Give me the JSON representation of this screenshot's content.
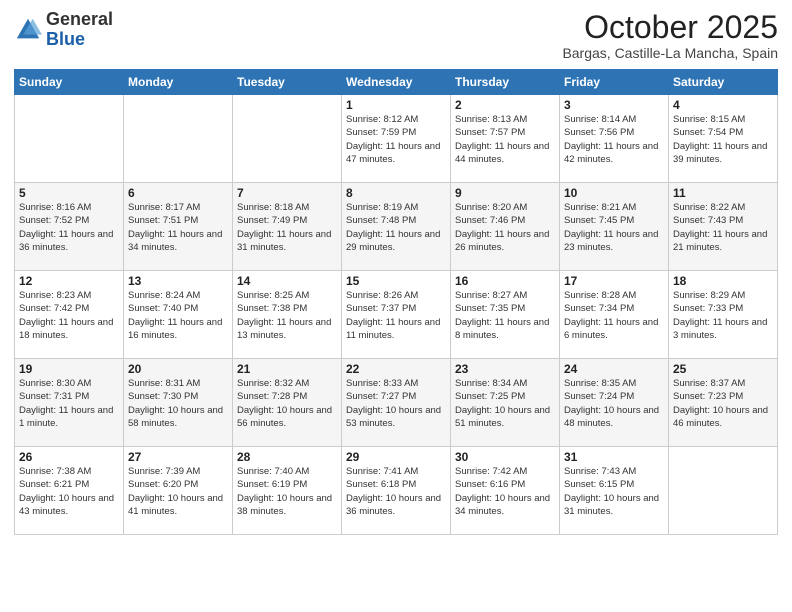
{
  "logo": {
    "general": "General",
    "blue": "Blue"
  },
  "header": {
    "month": "October 2025",
    "location": "Bargas, Castille-La Mancha, Spain"
  },
  "weekdays": [
    "Sunday",
    "Monday",
    "Tuesday",
    "Wednesday",
    "Thursday",
    "Friday",
    "Saturday"
  ],
  "weeks": [
    [
      {
        "day": "",
        "sunrise": "",
        "sunset": "",
        "daylight": ""
      },
      {
        "day": "",
        "sunrise": "",
        "sunset": "",
        "daylight": ""
      },
      {
        "day": "",
        "sunrise": "",
        "sunset": "",
        "daylight": ""
      },
      {
        "day": "1",
        "sunrise": "Sunrise: 8:12 AM",
        "sunset": "Sunset: 7:59 PM",
        "daylight": "Daylight: 11 hours and 47 minutes."
      },
      {
        "day": "2",
        "sunrise": "Sunrise: 8:13 AM",
        "sunset": "Sunset: 7:57 PM",
        "daylight": "Daylight: 11 hours and 44 minutes."
      },
      {
        "day": "3",
        "sunrise": "Sunrise: 8:14 AM",
        "sunset": "Sunset: 7:56 PM",
        "daylight": "Daylight: 11 hours and 42 minutes."
      },
      {
        "day": "4",
        "sunrise": "Sunrise: 8:15 AM",
        "sunset": "Sunset: 7:54 PM",
        "daylight": "Daylight: 11 hours and 39 minutes."
      }
    ],
    [
      {
        "day": "5",
        "sunrise": "Sunrise: 8:16 AM",
        "sunset": "Sunset: 7:52 PM",
        "daylight": "Daylight: 11 hours and 36 minutes."
      },
      {
        "day": "6",
        "sunrise": "Sunrise: 8:17 AM",
        "sunset": "Sunset: 7:51 PM",
        "daylight": "Daylight: 11 hours and 34 minutes."
      },
      {
        "day": "7",
        "sunrise": "Sunrise: 8:18 AM",
        "sunset": "Sunset: 7:49 PM",
        "daylight": "Daylight: 11 hours and 31 minutes."
      },
      {
        "day": "8",
        "sunrise": "Sunrise: 8:19 AM",
        "sunset": "Sunset: 7:48 PM",
        "daylight": "Daylight: 11 hours and 29 minutes."
      },
      {
        "day": "9",
        "sunrise": "Sunrise: 8:20 AM",
        "sunset": "Sunset: 7:46 PM",
        "daylight": "Daylight: 11 hours and 26 minutes."
      },
      {
        "day": "10",
        "sunrise": "Sunrise: 8:21 AM",
        "sunset": "Sunset: 7:45 PM",
        "daylight": "Daylight: 11 hours and 23 minutes."
      },
      {
        "day": "11",
        "sunrise": "Sunrise: 8:22 AM",
        "sunset": "Sunset: 7:43 PM",
        "daylight": "Daylight: 11 hours and 21 minutes."
      }
    ],
    [
      {
        "day": "12",
        "sunrise": "Sunrise: 8:23 AM",
        "sunset": "Sunset: 7:42 PM",
        "daylight": "Daylight: 11 hours and 18 minutes."
      },
      {
        "day": "13",
        "sunrise": "Sunrise: 8:24 AM",
        "sunset": "Sunset: 7:40 PM",
        "daylight": "Daylight: 11 hours and 16 minutes."
      },
      {
        "day": "14",
        "sunrise": "Sunrise: 8:25 AM",
        "sunset": "Sunset: 7:38 PM",
        "daylight": "Daylight: 11 hours and 13 minutes."
      },
      {
        "day": "15",
        "sunrise": "Sunrise: 8:26 AM",
        "sunset": "Sunset: 7:37 PM",
        "daylight": "Daylight: 11 hours and 11 minutes."
      },
      {
        "day": "16",
        "sunrise": "Sunrise: 8:27 AM",
        "sunset": "Sunset: 7:35 PM",
        "daylight": "Daylight: 11 hours and 8 minutes."
      },
      {
        "day": "17",
        "sunrise": "Sunrise: 8:28 AM",
        "sunset": "Sunset: 7:34 PM",
        "daylight": "Daylight: 11 hours and 6 minutes."
      },
      {
        "day": "18",
        "sunrise": "Sunrise: 8:29 AM",
        "sunset": "Sunset: 7:33 PM",
        "daylight": "Daylight: 11 hours and 3 minutes."
      }
    ],
    [
      {
        "day": "19",
        "sunrise": "Sunrise: 8:30 AM",
        "sunset": "Sunset: 7:31 PM",
        "daylight": "Daylight: 11 hours and 1 minute."
      },
      {
        "day": "20",
        "sunrise": "Sunrise: 8:31 AM",
        "sunset": "Sunset: 7:30 PM",
        "daylight": "Daylight: 10 hours and 58 minutes."
      },
      {
        "day": "21",
        "sunrise": "Sunrise: 8:32 AM",
        "sunset": "Sunset: 7:28 PM",
        "daylight": "Daylight: 10 hours and 56 minutes."
      },
      {
        "day": "22",
        "sunrise": "Sunrise: 8:33 AM",
        "sunset": "Sunset: 7:27 PM",
        "daylight": "Daylight: 10 hours and 53 minutes."
      },
      {
        "day": "23",
        "sunrise": "Sunrise: 8:34 AM",
        "sunset": "Sunset: 7:25 PM",
        "daylight": "Daylight: 10 hours and 51 minutes."
      },
      {
        "day": "24",
        "sunrise": "Sunrise: 8:35 AM",
        "sunset": "Sunset: 7:24 PM",
        "daylight": "Daylight: 10 hours and 48 minutes."
      },
      {
        "day": "25",
        "sunrise": "Sunrise: 8:37 AM",
        "sunset": "Sunset: 7:23 PM",
        "daylight": "Daylight: 10 hours and 46 minutes."
      }
    ],
    [
      {
        "day": "26",
        "sunrise": "Sunrise: 7:38 AM",
        "sunset": "Sunset: 6:21 PM",
        "daylight": "Daylight: 10 hours and 43 minutes."
      },
      {
        "day": "27",
        "sunrise": "Sunrise: 7:39 AM",
        "sunset": "Sunset: 6:20 PM",
        "daylight": "Daylight: 10 hours and 41 minutes."
      },
      {
        "day": "28",
        "sunrise": "Sunrise: 7:40 AM",
        "sunset": "Sunset: 6:19 PM",
        "daylight": "Daylight: 10 hours and 38 minutes."
      },
      {
        "day": "29",
        "sunrise": "Sunrise: 7:41 AM",
        "sunset": "Sunset: 6:18 PM",
        "daylight": "Daylight: 10 hours and 36 minutes."
      },
      {
        "day": "30",
        "sunrise": "Sunrise: 7:42 AM",
        "sunset": "Sunset: 6:16 PM",
        "daylight": "Daylight: 10 hours and 34 minutes."
      },
      {
        "day": "31",
        "sunrise": "Sunrise: 7:43 AM",
        "sunset": "Sunset: 6:15 PM",
        "daylight": "Daylight: 10 hours and 31 minutes."
      },
      {
        "day": "",
        "sunrise": "",
        "sunset": "",
        "daylight": ""
      }
    ]
  ]
}
